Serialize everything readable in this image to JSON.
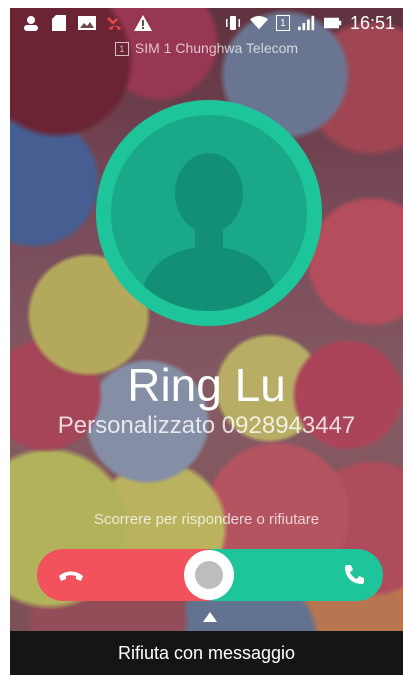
{
  "status_bar": {
    "time": "16:51",
    "icons": [
      "contact-icon",
      "sd-card-icon",
      "image-icon",
      "missed-call-icon",
      "warning-icon",
      "vibrate-icon",
      "wifi-icon",
      "sim1-icon",
      "signal-icon",
      "battery-icon"
    ],
    "sim1_label": "1"
  },
  "sim_info": {
    "badge": "1",
    "text": "SIM 1  Chunghwa Telecom"
  },
  "caller": {
    "name": "Ring Lu",
    "number_line": "Personalizzato 0928943447"
  },
  "slider": {
    "hint": "Scorrere per rispondere o rifiutare",
    "decline_color": "#f1525b",
    "answer_color": "#1fc59a"
  },
  "bottom_bar": {
    "label": "Rifiuta con messaggio"
  }
}
